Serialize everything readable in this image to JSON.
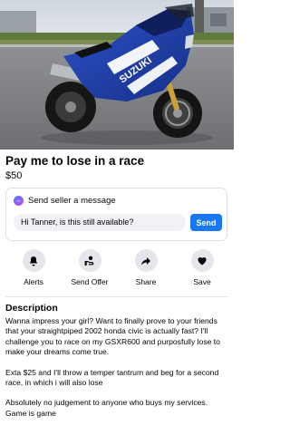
{
  "listing": {
    "title": "Pay me to lose in a race",
    "price": "$50",
    "photo_brand_text": "SUZUKI"
  },
  "message": {
    "header": "Send seller a message",
    "input_value": "Hi Tanner, is this still available?",
    "send_label": "Send"
  },
  "actions": [
    {
      "label": "Alerts",
      "icon": "bell-icon"
    },
    {
      "label": "Send Offer",
      "icon": "offer-icon"
    },
    {
      "label": "Share",
      "icon": "share-icon"
    },
    {
      "label": "Save",
      "icon": "heart-icon"
    }
  ],
  "description": {
    "heading": "Description",
    "paragraphs": [
      "Wanna impress your girl? Want to finally prove to your friends that your straightpiped 2002 honda civic is actually fast? I'll challenge you to race on my GSXR600 and purposfully lose to make your dreams come true.",
      "Exta $25 and I'll throw a temper tantrum and beg for a second race, in which i will also lose",
      "Absolutely no judgement to anyone who buys my services. Game is game"
    ]
  },
  "colors": {
    "accent": "#1877f2",
    "icon_bg": "#e4e6eb",
    "bike_blue": "#1f3fa8"
  }
}
